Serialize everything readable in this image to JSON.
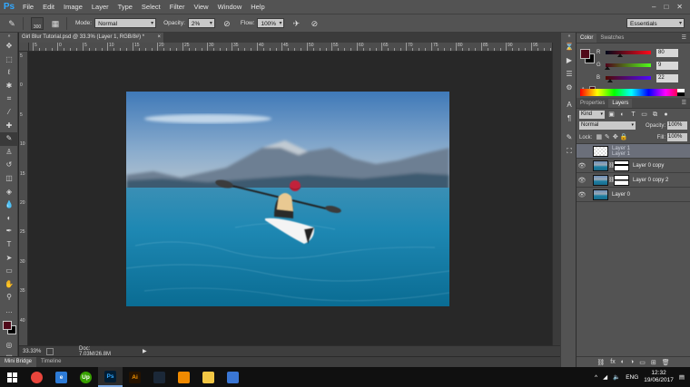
{
  "app": {
    "logo": "Ps",
    "menu": [
      "File",
      "Edit",
      "Image",
      "Layer",
      "Type",
      "Select",
      "Filter",
      "View",
      "Window",
      "Help"
    ],
    "window_controls": [
      "–",
      "□",
      "✕"
    ]
  },
  "options_bar": {
    "brush_size": "300",
    "mode_label": "Mode:",
    "mode_value": "Normal",
    "opacity_label": "Opacity:",
    "opacity_value": "2%",
    "flow_label": "Flow:",
    "flow_value": "100%",
    "workspace": "Essentials"
  },
  "document": {
    "tab_title": "Girl Blur Tutorial.psd @ 33.3% (Layer 1, RGB/8#) *",
    "tab_close": "×",
    "ruler_top_labels": [
      "5",
      "0",
      "5",
      "10",
      "15",
      "20",
      "25",
      "30",
      "35",
      "40",
      "45",
      "50",
      "55",
      "60",
      "65",
      "70",
      "75",
      "80",
      "85",
      "90",
      "95"
    ],
    "ruler_left_labels": [
      "5",
      "0",
      "5",
      "10",
      "15",
      "20",
      "25",
      "30",
      "35",
      "40"
    ],
    "zoom": "33.33%",
    "doc_size": "Doc: 7.03M/26.8M",
    "status_arrow": "▶"
  },
  "bottom_tabs": [
    "Mini Bridge",
    "Timeline"
  ],
  "color_panel": {
    "tabs": [
      "Color",
      "Swatches"
    ],
    "fg_color": "#50091a",
    "bg_color": "#000000",
    "channels": [
      {
        "label": "R",
        "value": "80",
        "gradient": "linear-gradient(to right, #00091a, #ff091a)",
        "level": 0.31
      },
      {
        "label": "G",
        "value": "9",
        "gradient": "linear-gradient(to right, #50001a, #50ff1a)",
        "level": 0.04
      },
      {
        "label": "B",
        "value": "22",
        "gradient": "linear-gradient(to right, #500900, #5009ff)",
        "level": 0.09
      }
    ],
    "warning_icon": "⚠"
  },
  "layers_panel": {
    "tabs": [
      "Properties",
      "Layers"
    ],
    "kind_label": "Kind",
    "blend_mode": "Normal",
    "opacity_label": "Opacity:",
    "opacity_value": "100%",
    "lock_label": "Lock:",
    "fill_label": "Fill:",
    "fill_value": "100%",
    "layers": [
      {
        "name": "Layer 1",
        "sub": "Layer 1",
        "selected": true,
        "visible": false,
        "thumb": "check",
        "mask": ""
      },
      {
        "name": "Layer 0 copy",
        "sub": "",
        "selected": false,
        "visible": true,
        "thumb": "photo",
        "mask": "m1"
      },
      {
        "name": "Layer 0 copy 2",
        "sub": "",
        "selected": false,
        "visible": true,
        "thumb": "photo",
        "mask": "m2"
      },
      {
        "name": "Layer 0",
        "sub": "",
        "selected": false,
        "visible": true,
        "thumb": "photo",
        "mask": ""
      }
    ],
    "footer_icons": [
      "⛓",
      "fx",
      "◐",
      "◑",
      "▭",
      "⊞",
      "🗑"
    ]
  },
  "taskbar": {
    "apps": [
      {
        "name": "chrome-icon",
        "label": "",
        "color": "#e8453c"
      },
      {
        "name": "edge-icon",
        "label": "e",
        "color": "#2d7bd6"
      },
      {
        "name": "upwork-icon",
        "label": "Up",
        "color": "#37a000"
      },
      {
        "name": "photoshop-icon",
        "label": "Ps",
        "color": "#001d34"
      },
      {
        "name": "illustrator-icon",
        "label": "Ai",
        "color": "#261300"
      },
      {
        "name": "steam-icon",
        "label": "",
        "color": "#1b2838"
      },
      {
        "name": "vlc-icon",
        "label": "",
        "color": "#f08a00"
      },
      {
        "name": "file-explorer-icon",
        "label": "",
        "color": "#f2c744"
      },
      {
        "name": "notepad-icon",
        "label": "",
        "color": "#3a76d4"
      }
    ],
    "language": "ENG",
    "time": "12:32",
    "date": "19/06/2017"
  }
}
